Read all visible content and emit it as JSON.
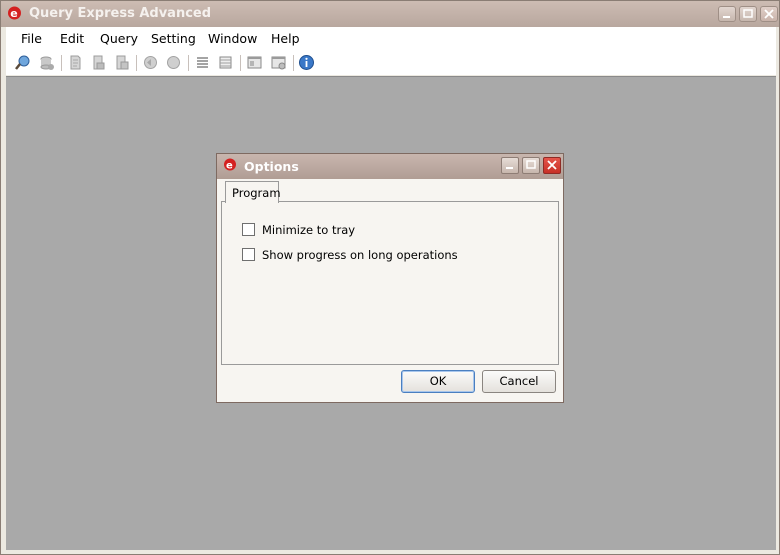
{
  "app": {
    "title": "Query Express Advanced"
  },
  "window_controls": {
    "minimize": "minimize-icon",
    "maximize": "maximize-icon",
    "close": "close-icon"
  },
  "menu": [
    {
      "label": "File"
    },
    {
      "label": "Edit"
    },
    {
      "label": "Query"
    },
    {
      "label": "Setting"
    },
    {
      "label": "Window"
    },
    {
      "label": "Help"
    }
  ],
  "toolbar": {
    "icons": [
      "connect-icon",
      "disconnect-icon",
      "new-query-icon",
      "open-icon",
      "save-icon",
      "execute-icon",
      "stop-icon",
      "results-text-icon",
      "results-grid-icon",
      "tile-icon",
      "properties-icon",
      "about-icon"
    ]
  },
  "dialog": {
    "title": "Options",
    "tab": "Program",
    "options": [
      {
        "label": "Minimize to tray",
        "checked": false
      },
      {
        "label": "Show progress on long operations",
        "checked": false
      }
    ],
    "ok_label": "OK",
    "cancel_label": "Cancel"
  },
  "colors": {
    "titlebar": "#b8a79e",
    "mdi_background": "#a9a9a9",
    "close_button": "#d9433a",
    "logo": "#d42020"
  }
}
